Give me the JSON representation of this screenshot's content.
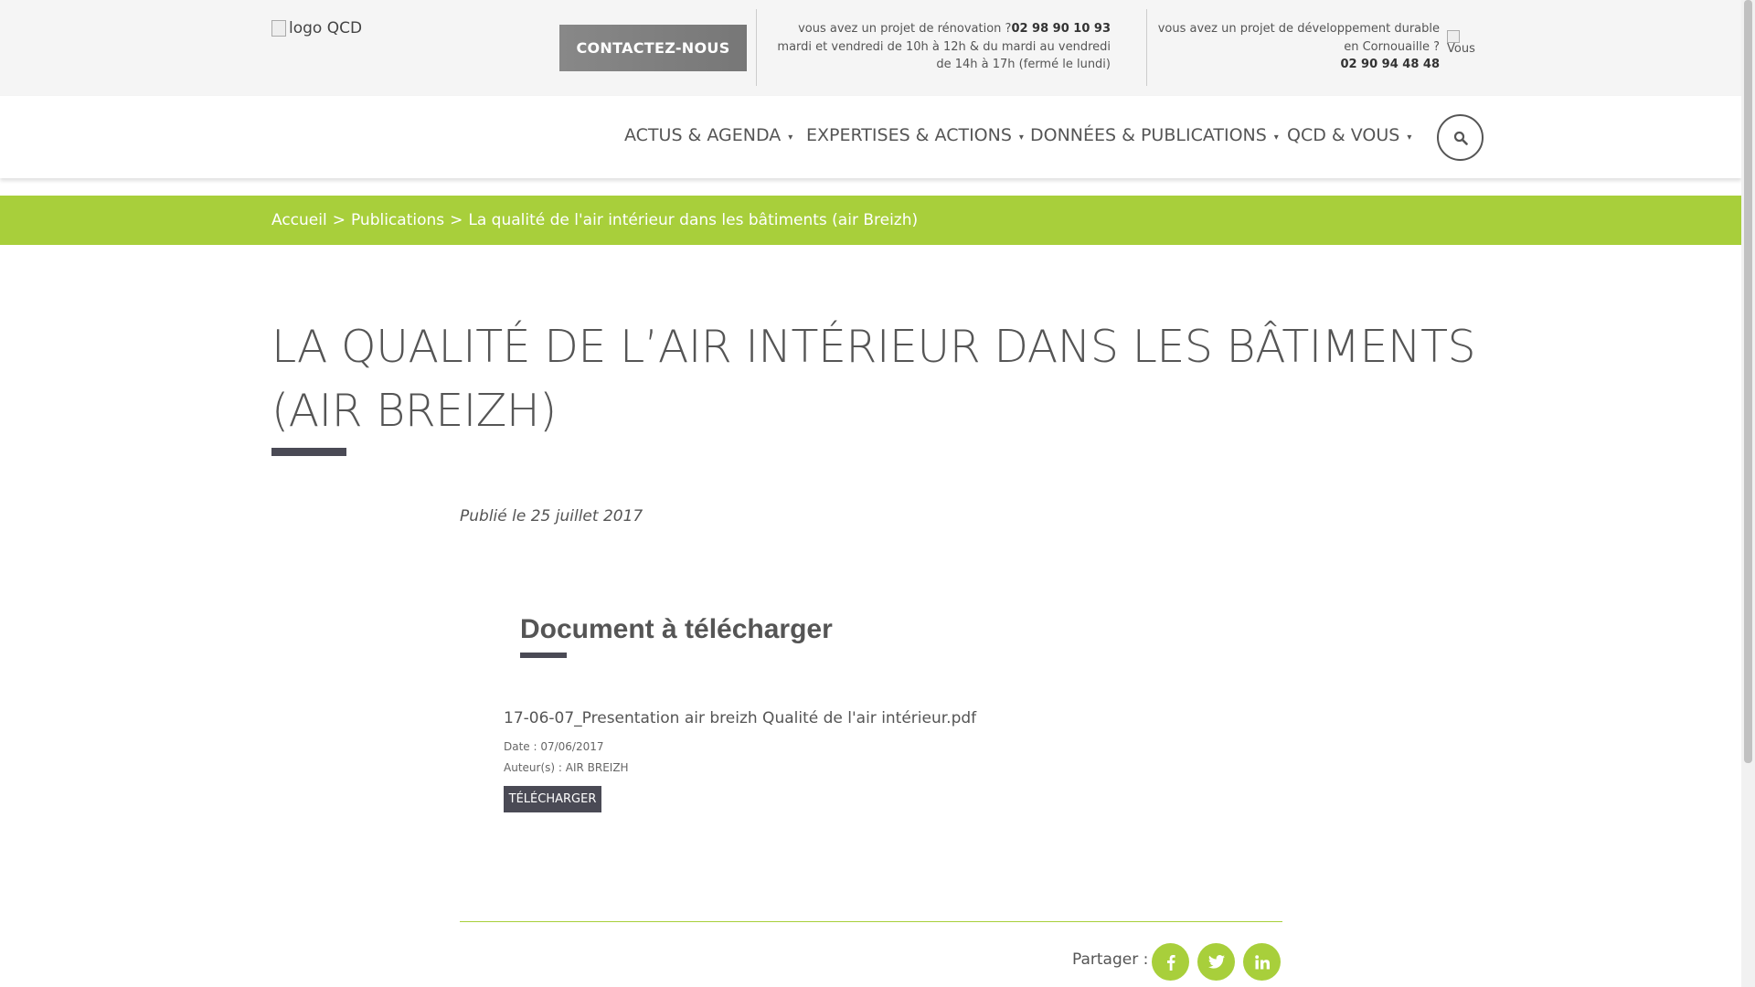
{
  "header": {
    "logo_alt": "logo QCD",
    "contact_button": "CONTACTEZ-NOUS",
    "renovation": {
      "line1": "vous avez un projet de rénovation ?",
      "phone": "02 98 90 10 93",
      "hours": "mardi et vendredi de 10h à 12h & du mardi au vendredi de 14h à 17h (fermé le lundi)"
    },
    "developpement": {
      "line1": "vous avez un projet de développement durable en Cornouaille ?",
      "phone": "02 90 94 48 48"
    },
    "vous_alt": "Vous"
  },
  "nav": {
    "items": [
      {
        "label": "ACTUS & AGENDA"
      },
      {
        "label": "EXPERTISES & ACTIONS"
      },
      {
        "label": "DONNÉES & PUBLICATIONS"
      },
      {
        "label": "QCD & VOUS"
      }
    ],
    "search_icon": "search-icon"
  },
  "breadcrumb": {
    "home": "Accueil",
    "sep": ">",
    "section": "Publications",
    "current": "La qualité de l'air intérieur dans les bâtiments (air Breizh)"
  },
  "page": {
    "title": "LA QUALITÉ DE L’AIR INTÉRIEUR DANS LES BÂTIMENTS (AIR BREIZH)",
    "published": "Publié le 25 juillet 2017"
  },
  "document": {
    "heading": "Document à télécharger",
    "file_name": "17-06-07_Presentation air breizh Qualité de l'air intérieur.pdf",
    "date": "Date : 07/06/2017",
    "author": "Auteur(s) : AIR BREIZH",
    "download_label": "TÉLÉCHARGER"
  },
  "share": {
    "label": "Partager :",
    "icons": [
      "facebook-icon",
      "twitter-icon",
      "linkedin-icon"
    ]
  },
  "colors": {
    "accent_green": "#a8cf3b",
    "dark": "#4a4a55"
  }
}
